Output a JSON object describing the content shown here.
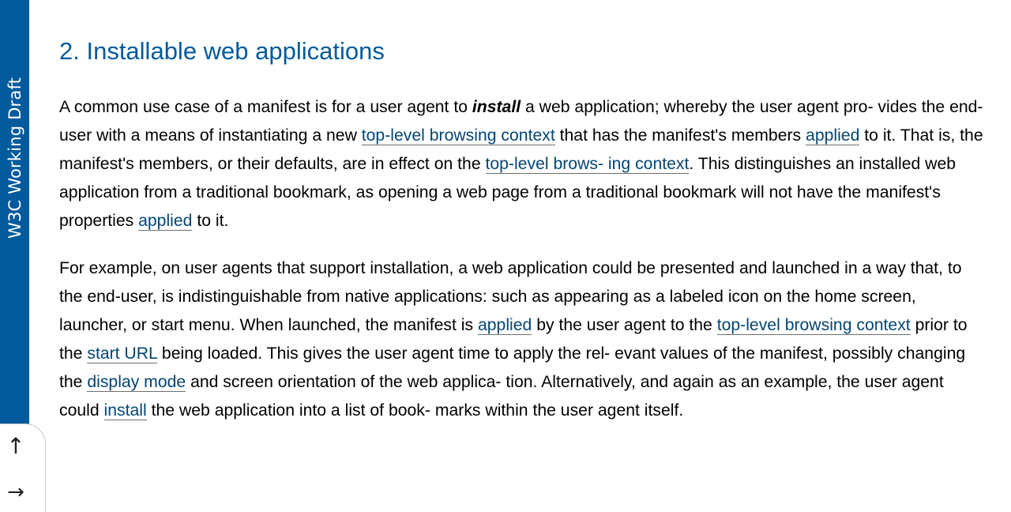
{
  "sidebar": {
    "label": "W3C Working Draft",
    "background_color": "#005a9c"
  },
  "nav": {
    "up_arrow": "↑",
    "right_arrow": "→",
    "up_icon": "arrow-up-icon",
    "right_icon": "arrow-right-icon"
  },
  "section": {
    "title": "2. Installable web applications",
    "title_color": "#005a9c"
  },
  "paragraph1": {
    "t1": "A common use case of a manifest is for a user agent to ",
    "dfn_install": "install",
    "t2": " a web application; whereby the user agent pro- vides the end-user with a means of instantiating a new ",
    "link_tlbc": "top-level browsing context",
    "t3": " that has the manifest's members ",
    "link_applied1": "applied",
    "t4": " to it. That is, the manifest's members, or their defaults, are in effect on the ",
    "link_tlbc2": "top-level brows- ing context",
    "t5": ". This distinguishes an installed web application from a traditional bookmark, as opening a web page from a traditional bookmark will not have the manifest's properties ",
    "link_applied2": "applied",
    "t6": " to it."
  },
  "paragraph2": {
    "t1": "For example, on user agents that support installation, a web application could be presented and launched in a way that, to the end-user, is indistinguishable from native applications: such as appearing as a labeled icon on the home screen, launcher, or start menu. When launched, the manifest is ",
    "link_applied": "applied",
    "t2": " by the user agent to the ",
    "link_tlbc": "top-level browsing context",
    "t3": " prior to the ",
    "link_start_url": "start URL",
    "t4": " being loaded. This gives the user agent time to apply the rel- evant values of the manifest, possibly changing the ",
    "link_display_mode": "display mode",
    "t5": " and screen orientation of the web applica- tion. Alternatively, and again as an example, the user agent could ",
    "link_install": "install",
    "t6": " the web application into a list of book- marks within the user agent itself."
  },
  "colors": {
    "link": "#034575",
    "text": "#000000"
  }
}
